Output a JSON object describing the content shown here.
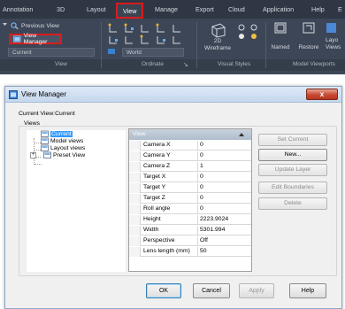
{
  "ribbon": {
    "tabs": [
      "Annotation",
      "3D",
      "Layout",
      "View",
      "Manage",
      "Export",
      "Cloud",
      "Application",
      "Help",
      "E"
    ],
    "active_tab": "View",
    "views_panel": {
      "previous_view": "Previous View",
      "view_manager": "View Manager",
      "current_combo": "Current",
      "title": "View"
    },
    "ordinate_panel": {
      "world_combo": "World",
      "title": "Ordinate"
    },
    "visual_styles_panel": {
      "wireframe_label_line1": "2D",
      "wireframe_label_line2": "Wireframe",
      "title": "Visual Styles"
    },
    "model_viewports_panel": {
      "named": "Named",
      "restore": "Restore",
      "layout": "Layo",
      "views": "Views",
      "title": "Model Viewports"
    }
  },
  "dialog": {
    "title": "View Manager",
    "close_label": "x",
    "current_view_label": "Current View:",
    "current_view_value": "Current",
    "views_group_label": "Views",
    "tree": [
      {
        "label": "Current",
        "selected": true
      },
      {
        "label": "Model views",
        "selected": false
      },
      {
        "label": "Layout views",
        "selected": false
      },
      {
        "label": "Preset View",
        "selected": false
      }
    ],
    "grid": {
      "header": "View",
      "rows": [
        {
          "name": "Camera X",
          "value": "0"
        },
        {
          "name": "Camera Y",
          "value": "0"
        },
        {
          "name": "Camera Z",
          "value": "1"
        },
        {
          "name": "Target X",
          "value": "0"
        },
        {
          "name": "Target Y",
          "value": "0"
        },
        {
          "name": "Target Z",
          "value": "0"
        },
        {
          "name": "Roll angle",
          "value": "0"
        },
        {
          "name": "Height",
          "value": "2223.9024"
        },
        {
          "name": "Width",
          "value": "5301.994"
        },
        {
          "name": "Perspective",
          "value": "Off"
        },
        {
          "name": "Lens length (mm)",
          "value": "50"
        }
      ]
    },
    "side_buttons": {
      "set_current": "Set Current",
      "new": "New...",
      "update_layer": "Update Layer",
      "edit_boundaries": "Edit Boundaries",
      "delete": "Delete"
    },
    "footer_buttons": {
      "ok": "OK",
      "cancel": "Cancel",
      "apply": "Apply",
      "help": "Help"
    }
  },
  "colors": {
    "ribbon_bg": "#3d4656",
    "highlight": "#d81c1c",
    "selection": "#3399ff"
  }
}
